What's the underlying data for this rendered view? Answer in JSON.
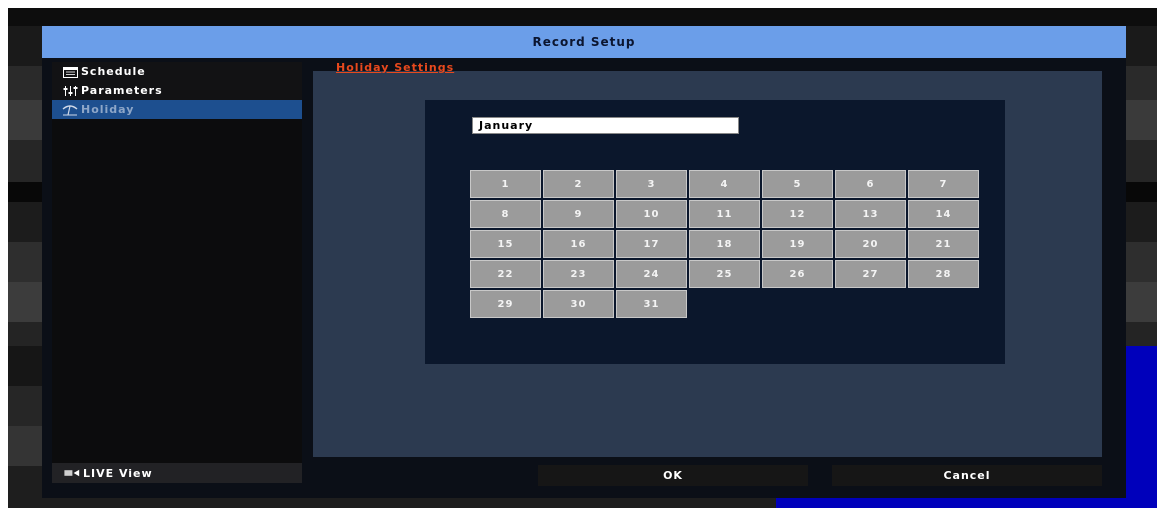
{
  "window": {
    "title": "Record Setup"
  },
  "sidebar": {
    "items": [
      {
        "label": "Schedule",
        "icon": "calendar-icon",
        "active": false
      },
      {
        "label": "Parameters",
        "icon": "sliders-icon",
        "active": false
      },
      {
        "label": "Holiday",
        "icon": "holiday-icon",
        "active": true
      }
    ],
    "live_view": {
      "label": "LIVE View",
      "icon": "live-view-icon"
    }
  },
  "main": {
    "section_title": "Holiday Settings",
    "month_select": {
      "value": "January",
      "icon": "dropdown-arrow-icon"
    },
    "days": [
      "1",
      "2",
      "3",
      "4",
      "5",
      "6",
      "7",
      "8",
      "9",
      "10",
      "11",
      "12",
      "13",
      "14",
      "15",
      "16",
      "17",
      "18",
      "19",
      "20",
      "21",
      "22",
      "23",
      "24",
      "25",
      "26",
      "27",
      "28",
      "29",
      "30",
      "31"
    ]
  },
  "footer": {
    "ok_label": "OK",
    "cancel_label": "Cancel"
  },
  "colors": {
    "titlebar": "#6b9ee9",
    "active_item": "#1d4f8f",
    "section_title": "#e8491d",
    "panel": "#2c3a50",
    "calendar_bg": "#0b172c",
    "day_cell": "#9b9b9b"
  }
}
